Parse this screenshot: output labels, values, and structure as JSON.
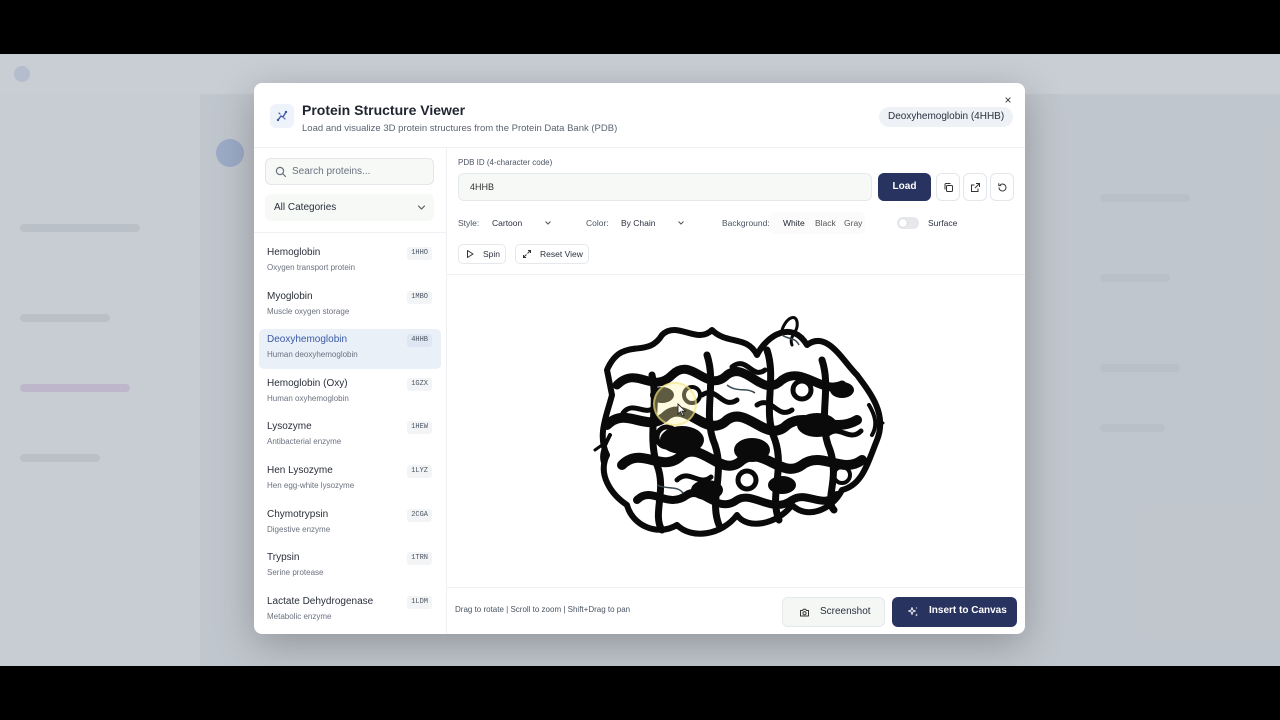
{
  "modal": {
    "title": "Protein Structure Viewer",
    "subtitle": "Load and visualize 3D protein structures from the Protein Data Bank (PDB)",
    "badge": "Deoxyhemoglobin (4HHB)",
    "close_label": "×"
  },
  "sidebar": {
    "search_placeholder": "Search proteins...",
    "category": "All Categories",
    "proteins": [
      {
        "name": "Hemoglobin",
        "desc": "Oxygen transport protein",
        "code": "1HHO",
        "active": false
      },
      {
        "name": "Myoglobin",
        "desc": "Muscle oxygen storage",
        "code": "1MBO",
        "active": false
      },
      {
        "name": "Deoxyhemoglobin",
        "desc": "Human deoxyhemoglobin",
        "code": "4HHB",
        "active": true
      },
      {
        "name": "Hemoglobin (Oxy)",
        "desc": "Human oxyhemoglobin",
        "code": "1GZX",
        "active": false
      },
      {
        "name": "Lysozyme",
        "desc": "Antibacterial enzyme",
        "code": "1HEW",
        "active": false
      },
      {
        "name": "Hen Lysozyme",
        "desc": "Hen egg-white lysozyme",
        "code": "1LYZ",
        "active": false
      },
      {
        "name": "Chymotrypsin",
        "desc": "Digestive enzyme",
        "code": "2CGA",
        "active": false
      },
      {
        "name": "Trypsin",
        "desc": "Serine protease",
        "code": "1TRN",
        "active": false
      },
      {
        "name": "Lactate Dehydrogenase",
        "desc": "Metabolic enzyme",
        "code": "1LDM",
        "active": false
      }
    ]
  },
  "controls": {
    "pdb_label": "PDB ID (4-character code)",
    "pdb_value": "4HHB",
    "load_label": "Load",
    "style_label": "Style:",
    "style_value": "Cartoon",
    "color_label": "Color:",
    "color_value": "By Chain",
    "background_label": "Background:",
    "background_options": [
      "White",
      "Black",
      "Gray"
    ],
    "background_selected": "White",
    "surface_label": "Surface",
    "spin_label": "Spin",
    "reset_label": "Reset View"
  },
  "footer": {
    "hint": "Drag to rotate | Scroll to zoom | Shift+Drag to pan",
    "screenshot_label": "Screenshot",
    "insert_label": "Insert to Canvas"
  },
  "colors": {
    "primary": "#28335f",
    "active_item_bg": "#e9f0f8",
    "active_item_text": "#3b5aa6",
    "structure": "#0a0a0a"
  },
  "icons": [
    "molecule-icon",
    "close-icon",
    "search-icon",
    "chevron-down-icon",
    "copy-icon",
    "external-link-icon",
    "refresh-icon",
    "play-icon",
    "expand-icon",
    "camera-icon",
    "sparkle-icon"
  ]
}
